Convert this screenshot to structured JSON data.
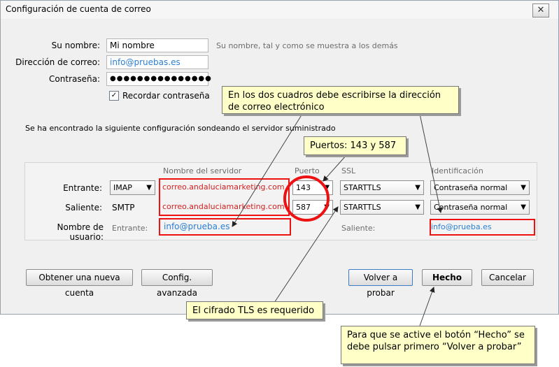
{
  "window": {
    "title": "Configuración de cuenta de correo",
    "close_symbol": "✕"
  },
  "form": {
    "name_label": "Su nombre:",
    "name_value": "Mi nombre",
    "name_hint": "Su nombre, tal y como se muestra a los demás",
    "email_label": "Dirección de correo:",
    "email_value": "info@pruebas.es",
    "password_label": "Contraseña:",
    "password_value": "●●●●●●●●●●●●●●●",
    "remember_label": "Recordar contraseña",
    "remember_checked": true
  },
  "found_text": "Se ha encontrado la siguiente configuración sondeando el servidor suministrado",
  "server": {
    "headers": {
      "server": "Nombre del servidor",
      "port": "Puerto",
      "ssl": "SSL",
      "auth": "Identificación"
    },
    "incoming": {
      "label": "Entrante:",
      "protocol": "IMAP",
      "host": "correo.andaluciamarketing.com",
      "port": "143",
      "ssl": "STARTTLS",
      "auth": "Contraseña normal"
    },
    "outgoing": {
      "label": "Saliente:",
      "protocol": "SMTP",
      "host": "correo.andaluciamarketing.com",
      "port": "587",
      "ssl": "STARTTLS",
      "auth": "Contraseña normal"
    },
    "username": {
      "label": "Nombre de usuario:",
      "in_label": "Entrante:",
      "in_value": "info@prueba.es",
      "out_label": "Saliente:",
      "out_value": "info@prueba.es"
    }
  },
  "buttons": {
    "new_account": "Obtener una nueva cuenta",
    "advanced": "Config. avanzada",
    "retest": "Volver a probar",
    "done": "Hecho",
    "cancel": "Cancelar"
  },
  "callouts": {
    "email_boxes": "En los dos cuadros debe escribirse la dirección de correo electrónico",
    "ports": "Puertos: 143 y 587",
    "tls": "El cifrado TLS es requerido",
    "done_hint": "Para que se active el botón “Hecho” se debe pulsar primero “Volver a probar”"
  },
  "colors": {
    "annotation_red": "#e11111",
    "callout_bg": "#ffffc8",
    "link_blue": "#2a7fd3"
  }
}
